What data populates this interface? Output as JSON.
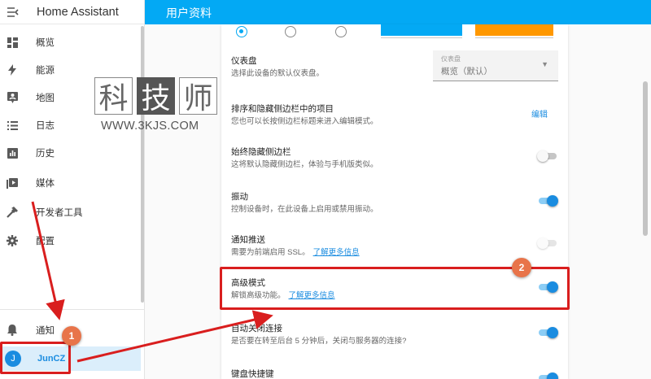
{
  "app": {
    "title": "Home Assistant"
  },
  "sidebar": {
    "items": [
      {
        "label": "概览",
        "icon": "dashboard-grid-icon"
      },
      {
        "label": "能源",
        "icon": "lightning-icon"
      },
      {
        "label": "地图",
        "icon": "map-person-icon"
      },
      {
        "label": "日志",
        "icon": "list-icon"
      },
      {
        "label": "历史",
        "icon": "bar-chart-icon"
      },
      {
        "label": "媒体",
        "icon": "media-play-icon"
      },
      {
        "label": "开发者工具",
        "icon": "hammer-icon"
      },
      {
        "label": "配置",
        "icon": "gear-icon"
      }
    ],
    "notifications": {
      "label": "通知",
      "icon": "bell-icon"
    },
    "user": {
      "initial": "J",
      "name": "JunCZ"
    }
  },
  "header": {
    "page_title": "用户资料"
  },
  "profile": {
    "dashboard": {
      "title": "仪表盘",
      "desc": "选择此设备的默认仪表盘。",
      "select_label": "仪表盘",
      "select_value": "概览（默认）"
    },
    "sidebar_order": {
      "title": "排序和隐藏侧边栏中的项目",
      "desc": "您也可以长按侧边栏标题来进入编辑模式。",
      "action": "编辑"
    },
    "hide_sidebar": {
      "title": "始终隐藏侧边栏",
      "desc": "这将默认隐藏侧边栏，体验与手机版类似。",
      "enabled": false
    },
    "vibrate": {
      "title": "振动",
      "desc": "控制设备时，在此设备上启用或禁用振动。",
      "enabled": true
    },
    "push": {
      "title": "通知推送",
      "desc": "需要为前端启用 SSL。",
      "link": "了解更多信息",
      "enabled": false
    },
    "advanced": {
      "title": "高级模式",
      "desc": "解锁高级功能。",
      "link": "了解更多信息",
      "enabled": true
    },
    "auto_close": {
      "title": "自动关闭连接",
      "desc": "是否要在转至后台 5 分钟后，关闭与服务器的连接?",
      "enabled": true
    },
    "shortcuts": {
      "title": "键盘快捷键"
    }
  },
  "watermark": {
    "chars": [
      "科",
      "技",
      "师"
    ],
    "url": "WWW.3KJS.COM"
  },
  "annotations": {
    "badge1": "1",
    "badge2": "2"
  },
  "colors": {
    "header": "#03a9f4",
    "accent": "#1a8ce0",
    "annotation": "#d91e1e",
    "badge": "#e8744a"
  }
}
